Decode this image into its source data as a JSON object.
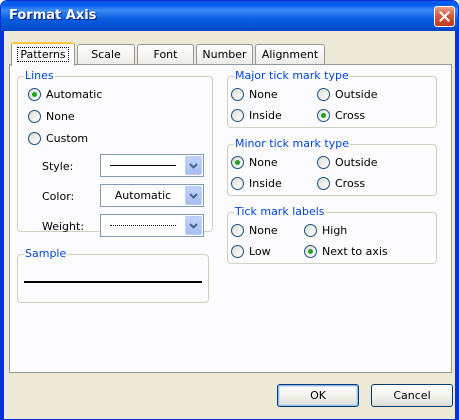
{
  "window": {
    "title": "Format Axis",
    "close_icon": "close-icon"
  },
  "tabs": [
    {
      "label": "Patterns",
      "active": true
    },
    {
      "label": "Scale",
      "active": false
    },
    {
      "label": "Font",
      "active": false
    },
    {
      "label": "Number",
      "active": false
    },
    {
      "label": "Alignment",
      "active": false
    }
  ],
  "lines": {
    "label": "Lines",
    "options": [
      {
        "label": "Automatic",
        "selected": true
      },
      {
        "label": "None",
        "selected": false
      },
      {
        "label": "Custom",
        "selected": false
      }
    ],
    "style_label": "Style:",
    "color_label": "Color:",
    "color_value": "Automatic",
    "weight_label": "Weight:"
  },
  "sample": {
    "label": "Sample"
  },
  "major_tick": {
    "label": "Major tick mark type",
    "options": [
      {
        "label": "None",
        "selected": false
      },
      {
        "label": "Outside",
        "selected": false
      },
      {
        "label": "Inside",
        "selected": false
      },
      {
        "label": "Cross",
        "selected": true
      }
    ]
  },
  "minor_tick": {
    "label": "Minor tick mark type",
    "options": [
      {
        "label": "None",
        "selected": true
      },
      {
        "label": "Outside",
        "selected": false
      },
      {
        "label": "Inside",
        "selected": false
      },
      {
        "label": "Cross",
        "selected": false
      }
    ]
  },
  "tick_labels": {
    "label": "Tick mark labels",
    "options": [
      {
        "label": "None",
        "selected": false
      },
      {
        "label": "High",
        "selected": false
      },
      {
        "label": "Low",
        "selected": false
      },
      {
        "label": "Next to axis",
        "selected": true
      }
    ]
  },
  "buttons": {
    "ok": "OK",
    "cancel": "Cancel"
  },
  "colors": {
    "title_bar": "#0058ee",
    "group_label": "#0046d5",
    "radio_selected": "#21a121",
    "dialog_bg": "#ece9d8"
  }
}
